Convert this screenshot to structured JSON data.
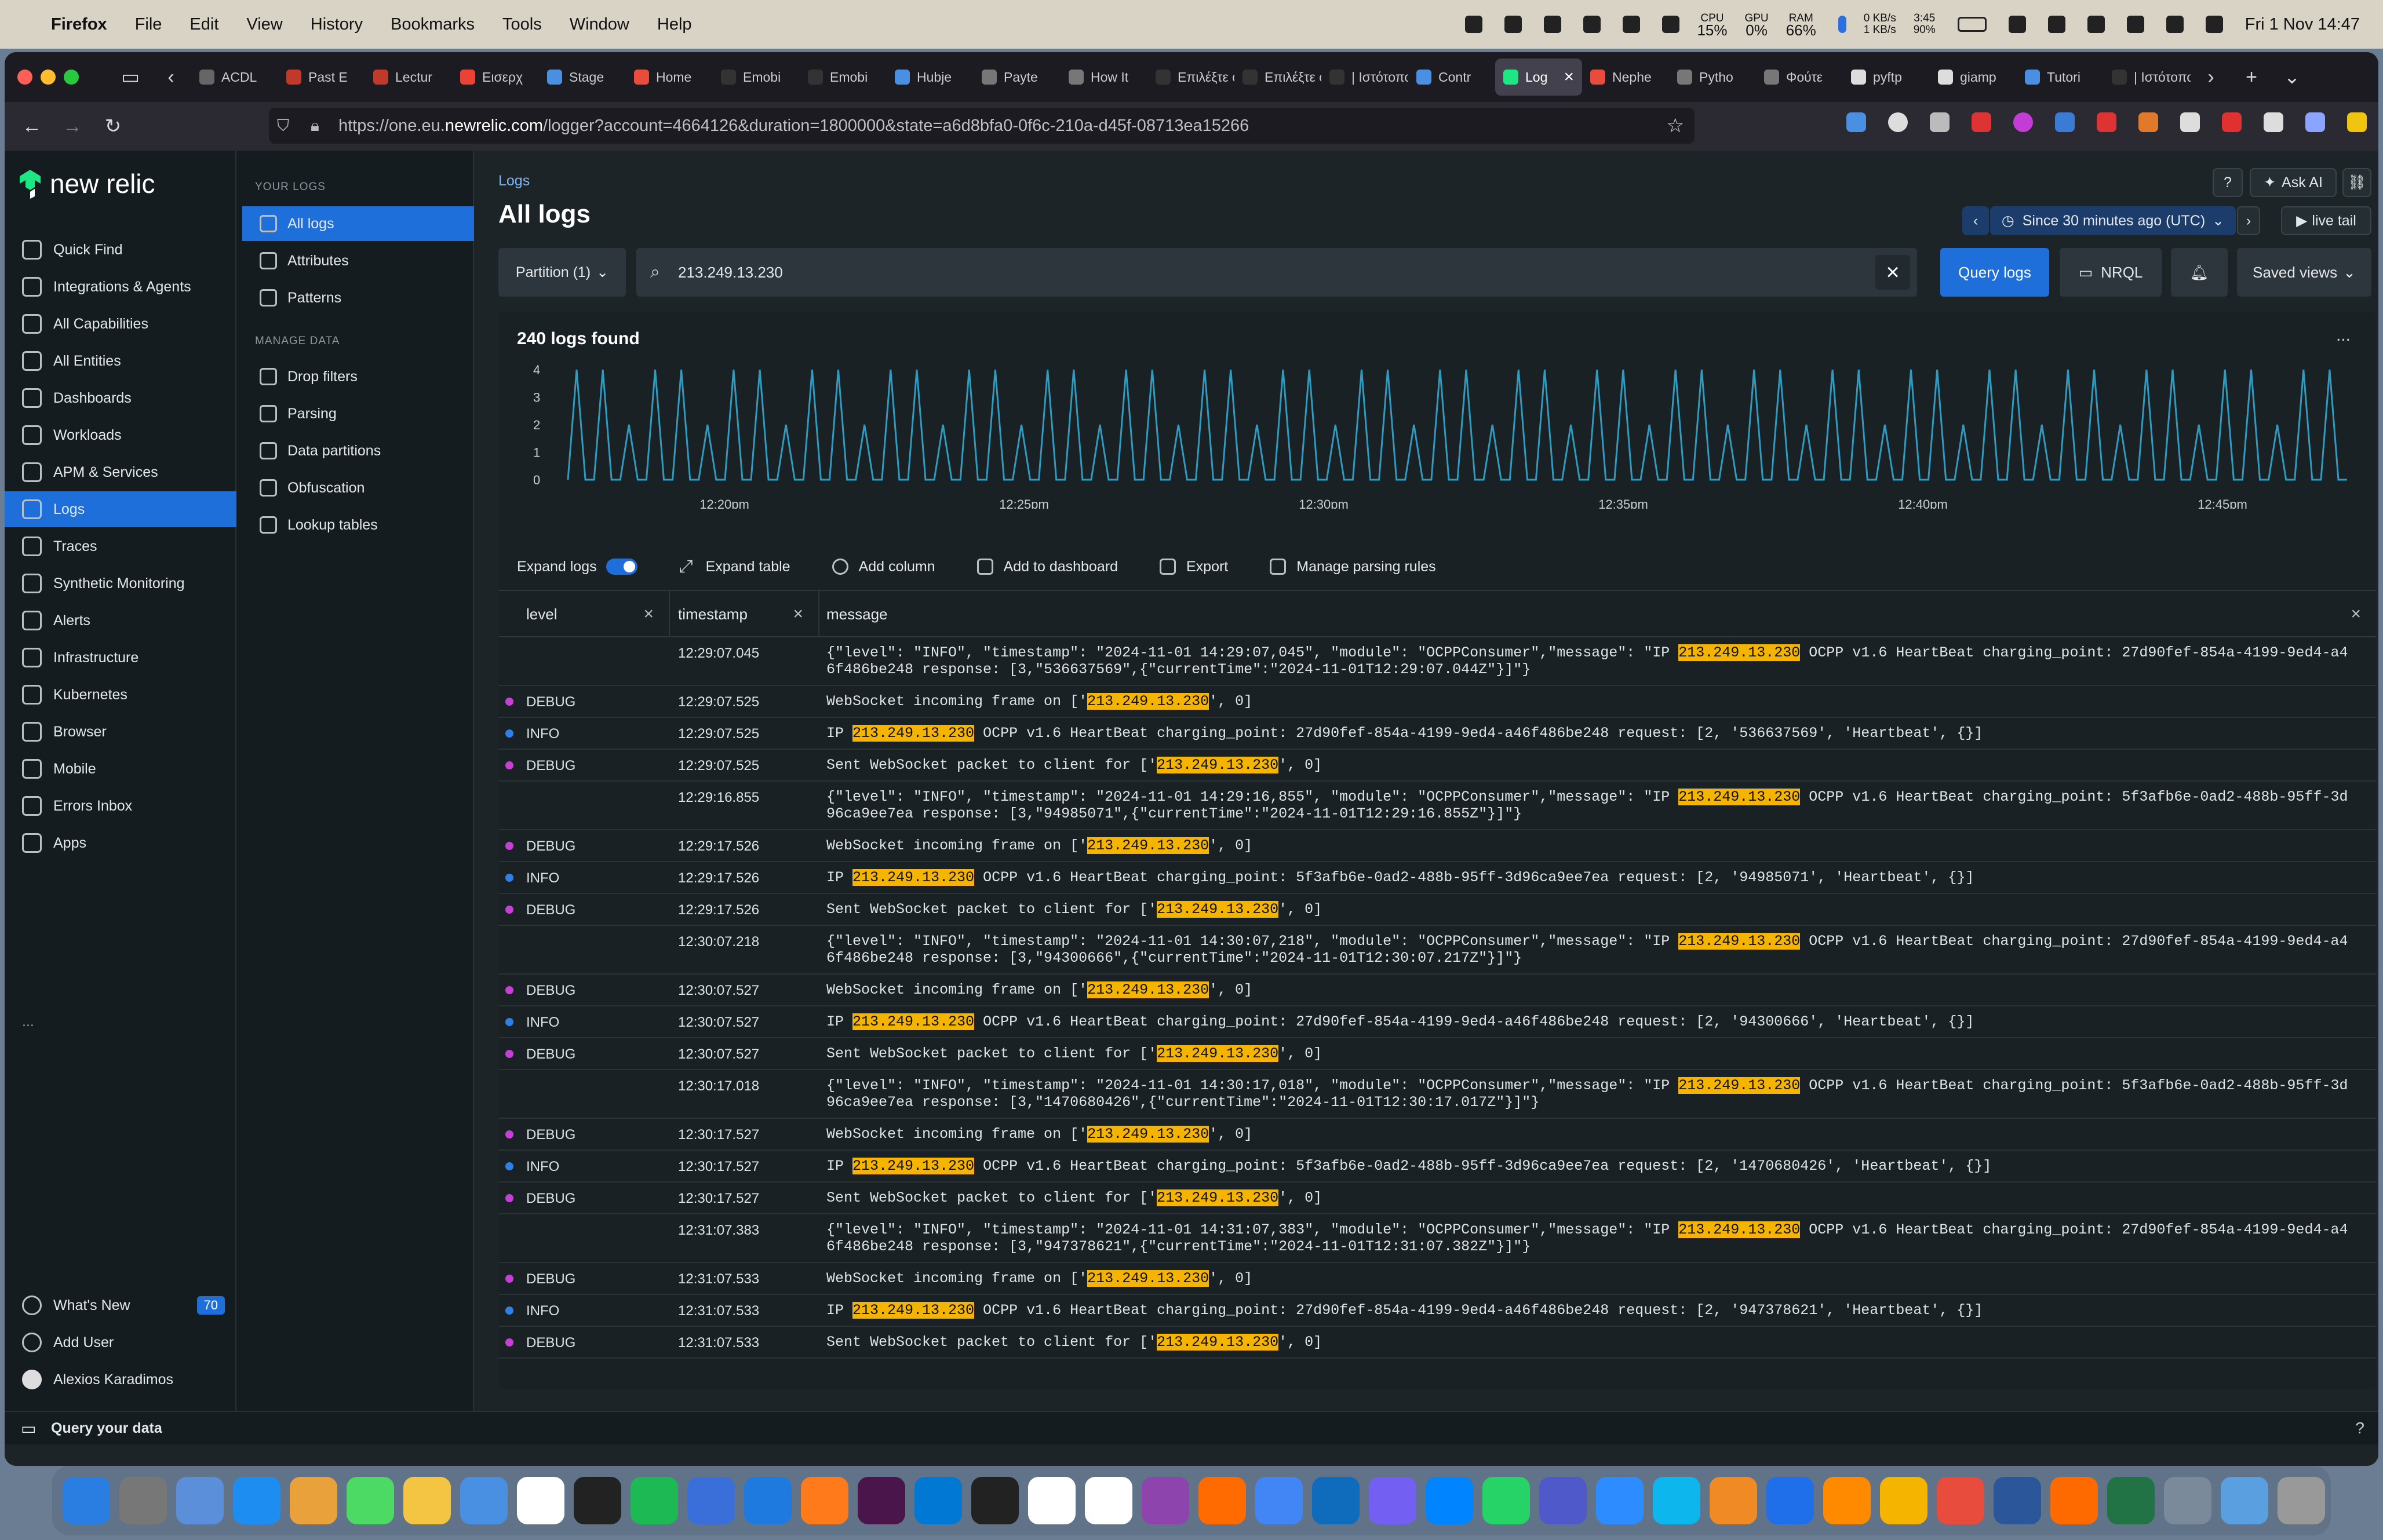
{
  "menubar": {
    "items": [
      "Firefox",
      "File",
      "Edit",
      "View",
      "History",
      "Bookmarks",
      "Tools",
      "Window",
      "Help"
    ],
    "cpu": {
      "label": "CPU",
      "value": "15%"
    },
    "gpu": {
      "label": "GPU",
      "value": "0%"
    },
    "ram": {
      "label": "RAM",
      "value": "66%"
    },
    "net": {
      "up": "0 KB/s",
      "down": "1 KB/s"
    },
    "battery_time": {
      "time": "3:45",
      "pct": "90%"
    },
    "clock": "Fri 1 Nov  14:47"
  },
  "tabs": [
    {
      "label": "ACDL",
      "color": "#666"
    },
    {
      "label": "Past E",
      "color": "#c0392b"
    },
    {
      "label": "Lectur",
      "color": "#c0392b"
    },
    {
      "label": "Εισερχ",
      "color": "#ea4335"
    },
    {
      "label": "Stage",
      "color": "#4a90e2"
    },
    {
      "label": "Home",
      "color": "#e74c3c"
    },
    {
      "label": "Emobi",
      "color": "#333"
    },
    {
      "label": "Emobi",
      "color": "#333"
    },
    {
      "label": "Hubje",
      "color": "#4a90e2"
    },
    {
      "label": "Payte",
      "color": "#777"
    },
    {
      "label": "How It",
      "color": "#777"
    },
    {
      "label": "Επιλέξτε ο",
      "color": "#333"
    },
    {
      "label": "Επιλέξτε ο",
      "color": "#333"
    },
    {
      "label": "| Ιστότοπο",
      "color": "#333"
    },
    {
      "label": "Contr",
      "color": "#4a90e2"
    },
    {
      "label": "Log",
      "color": "#1ce783",
      "active": true
    },
    {
      "label": "Nephe",
      "color": "#e74c3c"
    },
    {
      "label": "Pytho",
      "color": "#777"
    },
    {
      "label": "Φούτε",
      "color": "#777"
    },
    {
      "label": "pyftp",
      "color": "#ddd"
    },
    {
      "label": "giamp",
      "color": "#ddd"
    },
    {
      "label": "Tutori",
      "color": "#4a90e2"
    },
    {
      "label": "| Ιστότοπο",
      "color": "#333"
    }
  ],
  "url": {
    "prefix": "https://one.eu.",
    "domain": "newrelic.com",
    "path": "/logger?account=4664126&duration=1800000&state=a6d8bfa0-0f6c-210a-d45f-08713ea15266"
  },
  "nav": {
    "logo": "new relic",
    "items": [
      "Quick Find",
      "Integrations & Agents",
      "All Capabilities",
      "All Entities",
      "Dashboards",
      "Workloads",
      "APM & Services",
      "Logs",
      "Traces",
      "Synthetic Monitoring",
      "Alerts",
      "Infrastructure",
      "Kubernetes",
      "Browser",
      "Mobile",
      "Errors Inbox",
      "Apps"
    ],
    "more": "...",
    "bottom": [
      "What's New",
      "Add User",
      "Alexios Karadimos"
    ],
    "whats_new_count": "70"
  },
  "subnav": {
    "your_logs_header": "YOUR LOGS",
    "your_logs": [
      "All logs",
      "Attributes",
      "Patterns"
    ],
    "manage_header": "MANAGE DATA",
    "manage": [
      "Drop filters",
      "Parsing",
      "Data partitions",
      "Obfuscation",
      "Lookup tables"
    ]
  },
  "main": {
    "breadcrumb": "Logs",
    "title": "All logs",
    "ask_ai": "Ask AI",
    "time_range": "Since 30 minutes ago (UTC)",
    "live_tail": "live tail",
    "partition": "Partition (1)",
    "query": "213.249.13.230",
    "query_button": "Query logs",
    "nrql_button": "NRQL",
    "saved_views": "Saved views",
    "found": "240 logs found",
    "more": "...",
    "toolbar": {
      "expand_logs": "Expand logs",
      "expand_table": "Expand table",
      "add_column": "Add column",
      "add_dashboard": "Add to dashboard",
      "export": "Export",
      "parsing_rules": "Manage parsing rules"
    },
    "columns": [
      "level",
      "timestamp",
      "message"
    ]
  },
  "chart_data": {
    "type": "line",
    "title": "",
    "x_ticks": [
      "12:20pm",
      "12:25pm",
      "12:30pm",
      "12:35pm",
      "12:40pm",
      "12:45pm"
    ],
    "y_ticks": [
      "0",
      "1",
      "2",
      "3",
      "4"
    ],
    "ylim": [
      0,
      4
    ],
    "series": [
      {
        "values": [
          0,
          4,
          0,
          0,
          4,
          0,
          0,
          2,
          0,
          0,
          4,
          0,
          0,
          4,
          0,
          0,
          2,
          0,
          0,
          4,
          0,
          0,
          4,
          0,
          0,
          2,
          0,
          0,
          4,
          0,
          0,
          4,
          0,
          0,
          2,
          0,
          0,
          4,
          0,
          0,
          4,
          0,
          0,
          2,
          0,
          0,
          4,
          0,
          0,
          4,
          0,
          0,
          2,
          0,
          0,
          4,
          0,
          0,
          4,
          0,
          0,
          2,
          0,
          0,
          4,
          0,
          0,
          4,
          0,
          0,
          2,
          0,
          0,
          4,
          0,
          0,
          4,
          0,
          0,
          2,
          0,
          0,
          4,
          0,
          0,
          4,
          0,
          0,
          2,
          0,
          0,
          4,
          0,
          0,
          4,
          0,
          0,
          2,
          0,
          0,
          4,
          0,
          0,
          4,
          0,
          0,
          2,
          0,
          0,
          4,
          0,
          0,
          4,
          0,
          0,
          2,
          0,
          0,
          4,
          0,
          0,
          4,
          0,
          0,
          2,
          0,
          0,
          4,
          0,
          0,
          4,
          0,
          0,
          2,
          0,
          0,
          4,
          0,
          0,
          4,
          0,
          0,
          2,
          0,
          0,
          4,
          0,
          0,
          4,
          0,
          0,
          2,
          0,
          0,
          4,
          0,
          0,
          4,
          0,
          0,
          2,
          0,
          0,
          4,
          0,
          0,
          4,
          0,
          0,
          2,
          0,
          0,
          4,
          0,
          0,
          4,
          0,
          0,
          2,
          0,
          0,
          4,
          0,
          0,
          4,
          0,
          0,
          2,
          0,
          0,
          4,
          0,
          0,
          4,
          0,
          0,
          2,
          0,
          0,
          4,
          0,
          0,
          4,
          0,
          0
        ]
      }
    ],
    "color": "#2f9bbf",
    "grid": false,
    "legend": "none"
  },
  "level_colors": {
    "DEBUG": "#c83fd6",
    "INFO": "#2f7fe8"
  },
  "rows": [
    {
      "level": "",
      "ts": "12:29:07.045",
      "msg": [
        [
          "{\"level\": \"INFO\", \"timestamp\": \"2024-11-01 14:29:07,045\", \"module\": \"OCPPConsumer\",\"message\": \"IP ",
          0
        ],
        [
          "213.249.13.230",
          1
        ],
        [
          " OCPP v1.6 HeartBeat charging_point: 27d90fef-854a-4199-9ed4-a46f486be248 response: [3,\"536637569\",{\"currentTime\":\"2024-11-01T12:29:07.044Z\"}]\"}",
          0
        ]
      ]
    },
    {
      "level": "DEBUG",
      "ts": "12:29:07.525",
      "msg": [
        [
          "WebSocket incoming frame on ['",
          0
        ],
        [
          "213.249.13.230",
          1
        ],
        [
          "', 0]",
          0
        ]
      ]
    },
    {
      "level": "INFO",
      "ts": "12:29:07.525",
      "msg": [
        [
          "IP ",
          0
        ],
        [
          "213.249.13.230",
          1
        ],
        [
          " OCPP v1.6 HeartBeat charging_point: 27d90fef-854a-4199-9ed4-a46f486be248 request: [2, '536637569', 'Heartbeat', {}]",
          0
        ]
      ]
    },
    {
      "level": "DEBUG",
      "ts": "12:29:07.525",
      "msg": [
        [
          "Sent WebSocket packet to client for ['",
          0
        ],
        [
          "213.249.13.230",
          1
        ],
        [
          "', 0]",
          0
        ]
      ]
    },
    {
      "level": "",
      "ts": "12:29:16.855",
      "msg": [
        [
          "{\"level\": \"INFO\", \"timestamp\": \"2024-11-01 14:29:16,855\", \"module\": \"OCPPConsumer\",\"message\": \"IP ",
          0
        ],
        [
          "213.249.13.230",
          1
        ],
        [
          " OCPP v1.6 HeartBeat charging_point: 5f3afb6e-0ad2-488b-95ff-3d96ca9ee7ea response: [3,\"94985071\",{\"currentTime\":\"2024-11-01T12:29:16.855Z\"}]\"}",
          0
        ]
      ]
    },
    {
      "level": "DEBUG",
      "ts": "12:29:17.526",
      "msg": [
        [
          "WebSocket incoming frame on ['",
          0
        ],
        [
          "213.249.13.230",
          1
        ],
        [
          "', 0]",
          0
        ]
      ]
    },
    {
      "level": "INFO",
      "ts": "12:29:17.526",
      "msg": [
        [
          "IP ",
          0
        ],
        [
          "213.249.13.230",
          1
        ],
        [
          " OCPP v1.6 HeartBeat charging_point: 5f3afb6e-0ad2-488b-95ff-3d96ca9ee7ea request: [2, '94985071', 'Heartbeat', {}]",
          0
        ]
      ]
    },
    {
      "level": "DEBUG",
      "ts": "12:29:17.526",
      "msg": [
        [
          "Sent WebSocket packet to client for ['",
          0
        ],
        [
          "213.249.13.230",
          1
        ],
        [
          "', 0]",
          0
        ]
      ]
    },
    {
      "level": "",
      "ts": "12:30:07.218",
      "msg": [
        [
          "{\"level\": \"INFO\", \"timestamp\": \"2024-11-01 14:30:07,218\", \"module\": \"OCPPConsumer\",\"message\": \"IP ",
          0
        ],
        [
          "213.249.13.230",
          1
        ],
        [
          " OCPP v1.6 HeartBeat charging_point: 27d90fef-854a-4199-9ed4-a46f486be248 response: [3,\"94300666\",{\"currentTime\":\"2024-11-01T12:30:07.217Z\"}]\"}",
          0
        ]
      ]
    },
    {
      "level": "DEBUG",
      "ts": "12:30:07.527",
      "msg": [
        [
          "WebSocket incoming frame on ['",
          0
        ],
        [
          "213.249.13.230",
          1
        ],
        [
          "', 0]",
          0
        ]
      ]
    },
    {
      "level": "INFO",
      "ts": "12:30:07.527",
      "msg": [
        [
          "IP ",
          0
        ],
        [
          "213.249.13.230",
          1
        ],
        [
          " OCPP v1.6 HeartBeat charging_point: 27d90fef-854a-4199-9ed4-a46f486be248 request: [2, '94300666', 'Heartbeat', {}]",
          0
        ]
      ]
    },
    {
      "level": "DEBUG",
      "ts": "12:30:07.527",
      "msg": [
        [
          "Sent WebSocket packet to client for ['",
          0
        ],
        [
          "213.249.13.230",
          1
        ],
        [
          "', 0]",
          0
        ]
      ]
    },
    {
      "level": "",
      "ts": "12:30:17.018",
      "msg": [
        [
          "{\"level\": \"INFO\", \"timestamp\": \"2024-11-01 14:30:17,018\", \"module\": \"OCPPConsumer\",\"message\": \"IP ",
          0
        ],
        [
          "213.249.13.230",
          1
        ],
        [
          " OCPP v1.6 HeartBeat charging_point: 5f3afb6e-0ad2-488b-95ff-3d96ca9ee7ea response: [3,\"1470680426\",{\"currentTime\":\"2024-11-01T12:30:17.017Z\"}]\"}",
          0
        ]
      ]
    },
    {
      "level": "DEBUG",
      "ts": "12:30:17.527",
      "msg": [
        [
          "WebSocket incoming frame on ['",
          0
        ],
        [
          "213.249.13.230",
          1
        ],
        [
          "', 0]",
          0
        ]
      ]
    },
    {
      "level": "INFO",
      "ts": "12:30:17.527",
      "msg": [
        [
          "IP ",
          0
        ],
        [
          "213.249.13.230",
          1
        ],
        [
          " OCPP v1.6 HeartBeat charging_point: 5f3afb6e-0ad2-488b-95ff-3d96ca9ee7ea request: [2, '1470680426', 'Heartbeat', {}]",
          0
        ]
      ]
    },
    {
      "level": "DEBUG",
      "ts": "12:30:17.527",
      "msg": [
        [
          "Sent WebSocket packet to client for ['",
          0
        ],
        [
          "213.249.13.230",
          1
        ],
        [
          "', 0]",
          0
        ]
      ]
    },
    {
      "level": "",
      "ts": "12:31:07.383",
      "msg": [
        [
          "{\"level\": \"INFO\", \"timestamp\": \"2024-11-01 14:31:07,383\", \"module\": \"OCPPConsumer\",\"message\": \"IP ",
          0
        ],
        [
          "213.249.13.230",
          1
        ],
        [
          " OCPP v1.6 HeartBeat charging_point: 27d90fef-854a-4199-9ed4-a46f486be248 response: [3,\"947378621\",{\"currentTime\":\"2024-11-01T12:31:07.382Z\"}]\"}",
          0
        ]
      ]
    },
    {
      "level": "DEBUG",
      "ts": "12:31:07.533",
      "msg": [
        [
          "WebSocket incoming frame on ['",
          0
        ],
        [
          "213.249.13.230",
          1
        ],
        [
          "', 0]",
          0
        ]
      ]
    },
    {
      "level": "INFO",
      "ts": "12:31:07.533",
      "msg": [
        [
          "IP ",
          0
        ],
        [
          "213.249.13.230",
          1
        ],
        [
          " OCPP v1.6 HeartBeat charging_point: 27d90fef-854a-4199-9ed4-a46f486be248 request: [2, '947378621', 'Heartbeat', {}]",
          0
        ]
      ]
    },
    {
      "level": "DEBUG",
      "ts": "12:31:07.533",
      "msg": [
        [
          "Sent WebSocket packet to client for ['",
          0
        ],
        [
          "213.249.13.230",
          1
        ],
        [
          "', 0]",
          0
        ]
      ]
    }
  ],
  "footer": {
    "query_your_data": "Query your data"
  },
  "dock_colors": [
    "#2a7de1",
    "#777",
    "#5b8fd9",
    "#1d8df2",
    "#e9a23b",
    "#4cd964",
    "#f4c542",
    "#4a90e2",
    "#fff",
    "#222",
    "#1db954",
    "#3a6fd9",
    "#1f7ae0",
    "#ff7a1a",
    "#4a154b",
    "#0078d4",
    "#222",
    "#fff",
    "#fff",
    "#8e44ad",
    "#ff6b00",
    "#4285f4",
    "#0f6cbd",
    "#7360f2",
    "#0084ff",
    "#25d366",
    "#5059c9",
    "#2d8cff",
    "#0db7ed",
    "#f08a24",
    "#1f6feb",
    "#ff8a00",
    "#f5b400",
    "#e74c3c",
    "#2b579a",
    "#ff6a00",
    "#217346",
    "#7a8a9a",
    "#5aa0e0",
    "#999"
  ]
}
